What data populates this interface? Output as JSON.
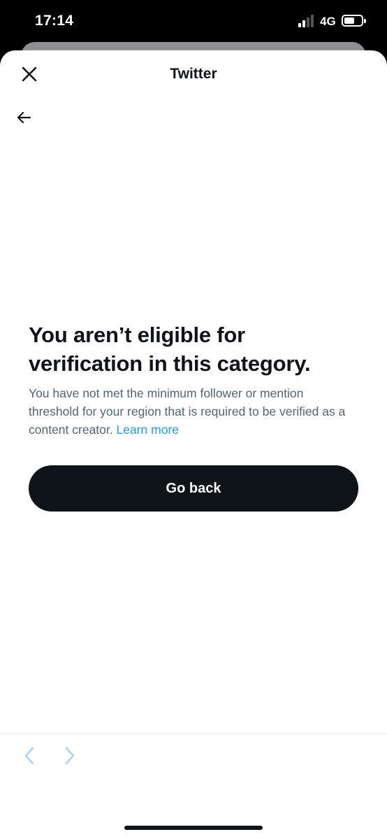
{
  "status_bar": {
    "time": "17:14",
    "network": "4G"
  },
  "sheet": {
    "title": "Twitter",
    "close_icon": "close-icon",
    "back_icon": "arrow-left-icon"
  },
  "content": {
    "headline": "You aren’t eligible for verification in this category.",
    "body": "You have not met the minimum follower or mention threshold for your region that is required to be verified as a content creator.",
    "learn_more": "Learn more",
    "button_label": "Go back"
  },
  "toolbar": {
    "back_icon": "chevron-left-icon",
    "forward_icon": "chevron-right-icon"
  },
  "colors": {
    "text_primary": "#0f1419",
    "text_secondary": "#536471",
    "link": "#1d9bf0",
    "button_bg": "#0f1419",
    "disabled_nav": "#a8d4f5"
  }
}
